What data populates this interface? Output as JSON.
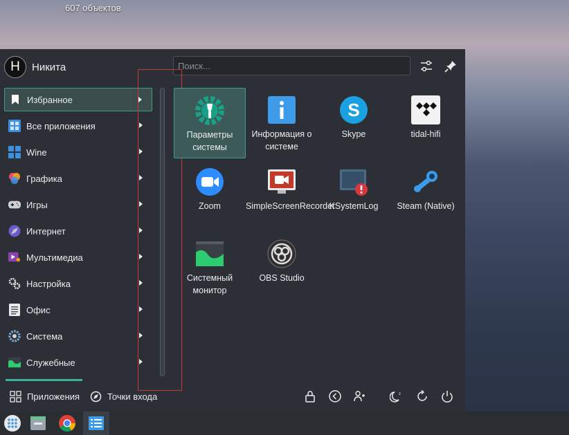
{
  "desktop": {
    "caption": "607 объектов"
  },
  "menu": {
    "user": {
      "initial": "Н",
      "name": "Никита"
    },
    "search": {
      "placeholder": "Поиск..."
    },
    "categories": [
      {
        "label": "Избранное",
        "icon": "bookmark-icon"
      },
      {
        "label": "Все приложения",
        "icon": "grid-apps-icon"
      },
      {
        "label": "Wine",
        "icon": "wine-icon"
      },
      {
        "label": "Графика",
        "icon": "graphics-icon"
      },
      {
        "label": "Игры",
        "icon": "gamepad-icon"
      },
      {
        "label": "Интернет",
        "icon": "internet-icon"
      },
      {
        "label": "Мультимедиа",
        "icon": "multimedia-icon"
      },
      {
        "label": "Настройка",
        "icon": "settings-gears-icon"
      },
      {
        "label": "Офис",
        "icon": "office-icon"
      },
      {
        "label": "Система",
        "icon": "system-gear-icon"
      },
      {
        "label": "Служебные",
        "icon": "utilities-icon"
      }
    ],
    "apps": [
      {
        "label": "Параметры системы",
        "icon": "system-settings-icon"
      },
      {
        "label": "Информация о системе",
        "icon": "info-icon"
      },
      {
        "label": "Skype",
        "icon": "skype-icon"
      },
      {
        "label": "tidal-hifi",
        "icon": "tidal-icon"
      },
      {
        "label": "Zoom",
        "icon": "zoom-icon"
      },
      {
        "label": "SimpleScreenRecorder",
        "icon": "screen-recorder-icon"
      },
      {
        "label": "KSystemLog",
        "icon": "ksystemlog-icon"
      },
      {
        "label": "Steam (Native)",
        "icon": "steam-icon"
      },
      {
        "label": "Системный монитор",
        "icon": "system-monitor-icon"
      },
      {
        "label": "OBS Studio",
        "icon": "obs-icon"
      }
    ],
    "tabs": {
      "apps_label": "Приложения",
      "places_label": "Точки входа"
    },
    "colors": {
      "accent": "#3db393",
      "highlight": "#3c5a57",
      "panel": "#2c3036",
      "annotation_box": "#c23b3b"
    }
  },
  "taskbar": {
    "icons": [
      "app-launcher-icon",
      "file-manager-icon",
      "chrome-icon",
      "task-manager-icon"
    ]
  }
}
